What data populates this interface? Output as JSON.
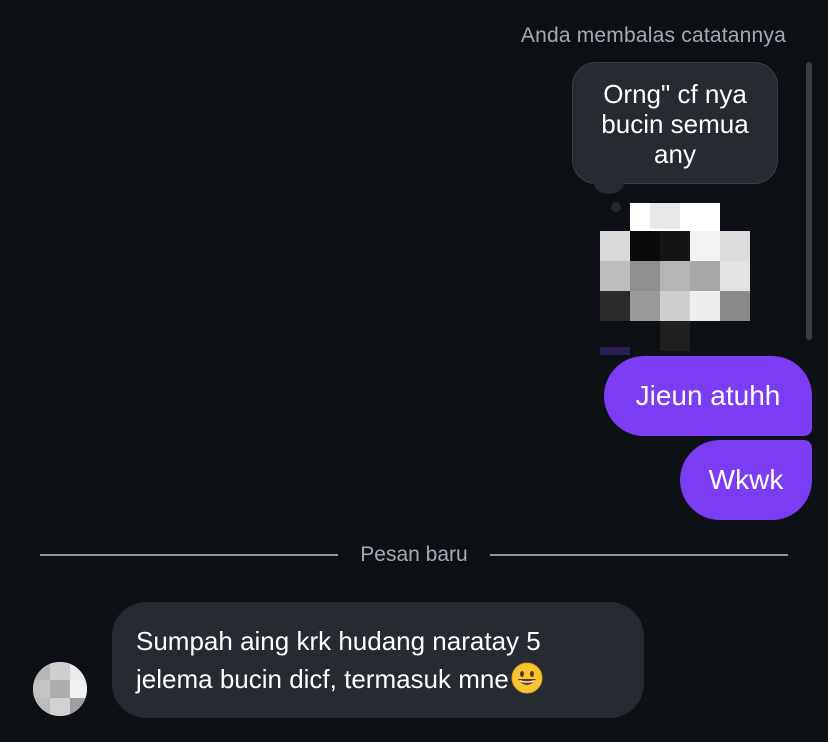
{
  "thread": {
    "reply_caption": "Anda membalas catatannya",
    "note_text": "Orng\" cf nya bucin semua any",
    "sent_messages": [
      {
        "text": "Jieun atuhh"
      },
      {
        "text": "Wkwk"
      }
    ],
    "divider_label": "Pesan baru",
    "received_message": {
      "text": "Sumpah aing krk hudang naratay 5 jelema bucin dicf, termasuk mne",
      "emoji": "grinning-face-icon"
    }
  },
  "colors": {
    "background": "#0d1116",
    "bubble_dark": "#262a31",
    "bubble_sent": "#7b3df4",
    "muted_text": "#a5a9b2"
  }
}
